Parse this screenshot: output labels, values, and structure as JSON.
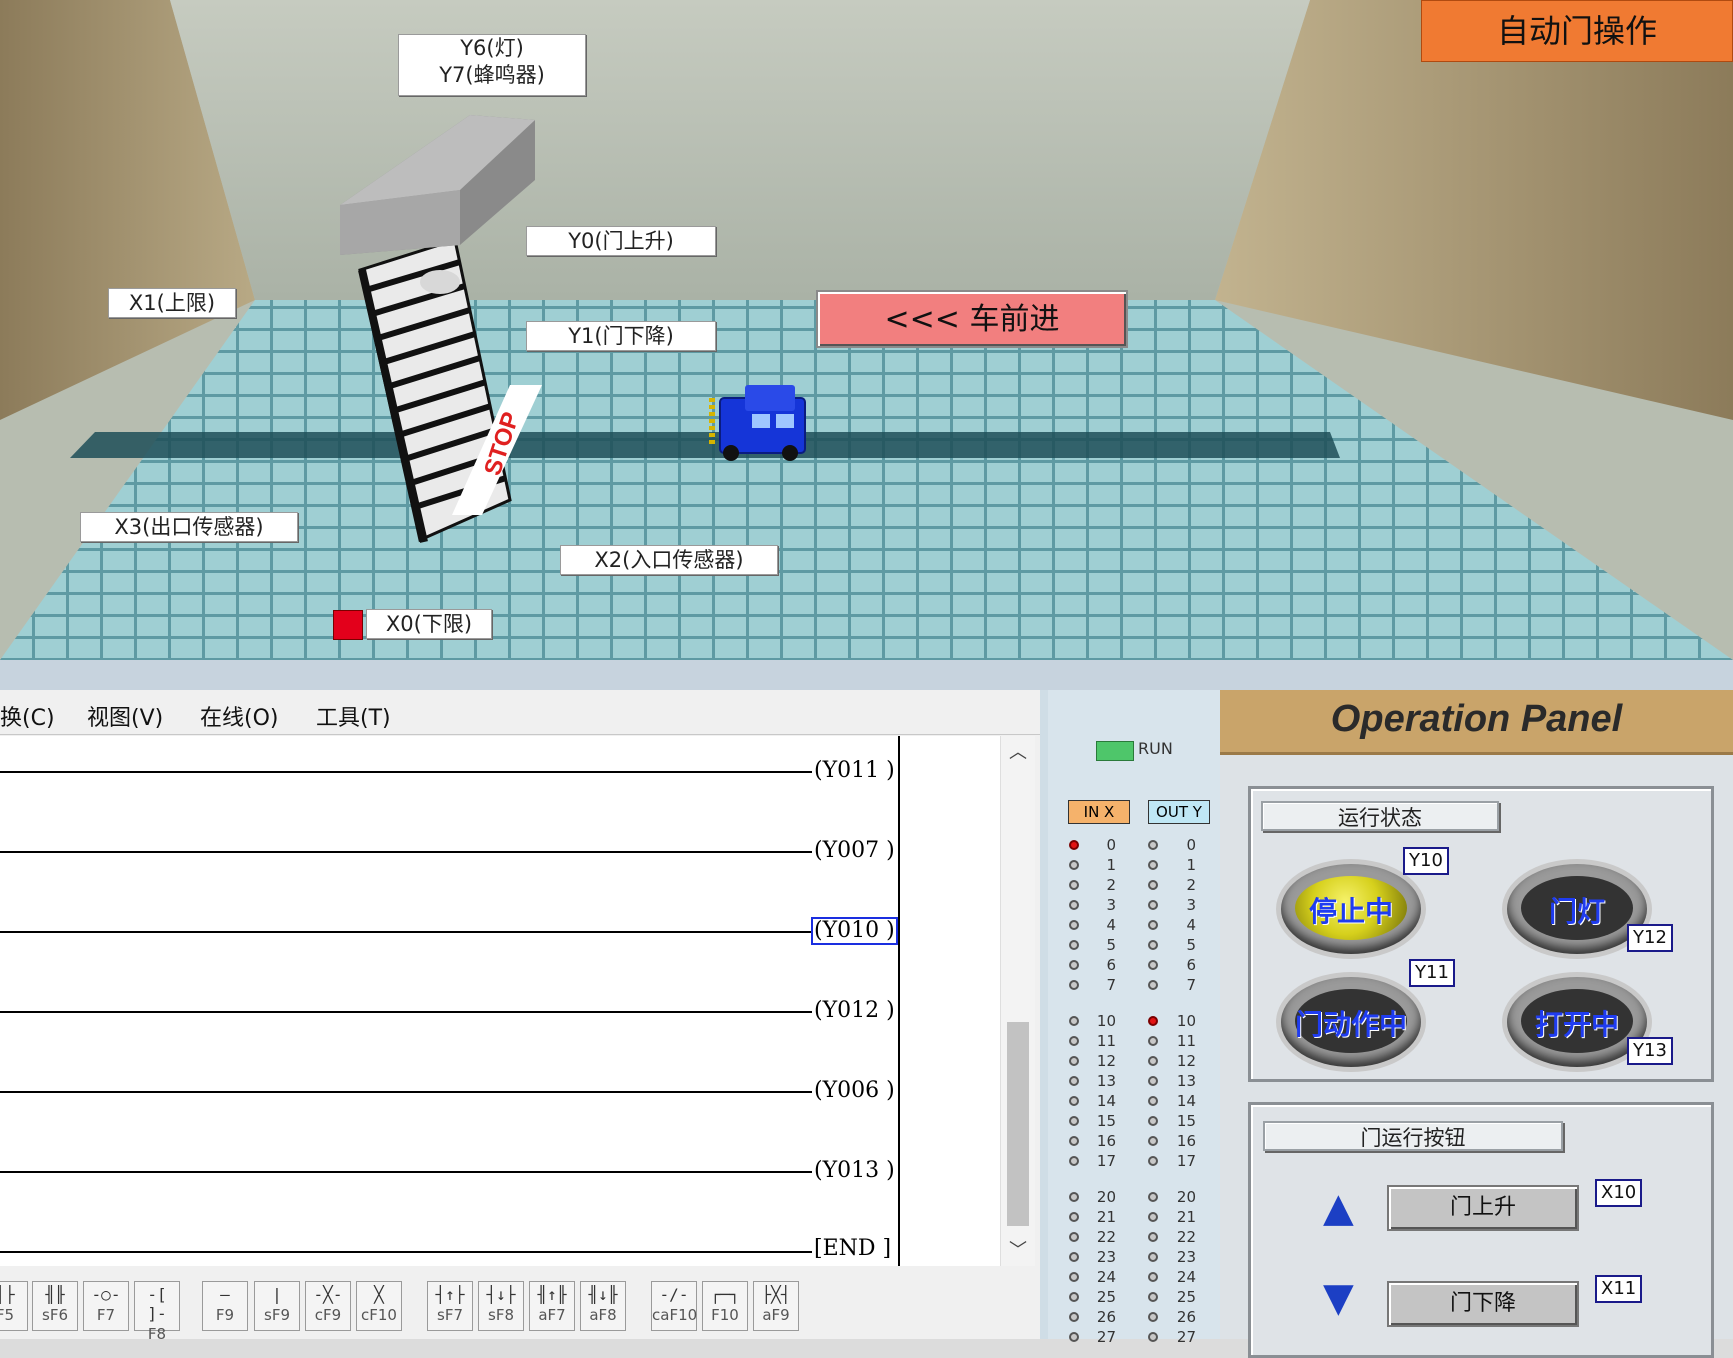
{
  "scene": {
    "title": "自动门操作",
    "car_button": "<<< 车前进",
    "stop_text": "STOP",
    "labels": {
      "y6y7_line1": "Y6(灯)",
      "y6y7_line2": "Y7(蜂鸣器)",
      "y0": "Y0(门上升)",
      "y1": "Y1(门下降)",
      "x1": "X1(上限)",
      "x3": "X3(出口传感器)",
      "x2": "X2(入口传感器)",
      "x0": "X0(下限)"
    }
  },
  "editor": {
    "menu": [
      "换(C)",
      "视图(V)",
      "在线(O)",
      "工具(T)"
    ],
    "coils": [
      "(Y011 )",
      "(Y007 )",
      "(Y010 )",
      "(Y012 )",
      "(Y006 )",
      "(Y013 )",
      "[END ]"
    ],
    "function_keys": [
      {
        "sym": "┤├",
        "label": "F5"
      },
      {
        "sym": "╢╟",
        "label": "sF6"
      },
      {
        "sym": "-○-",
        "label": "F7"
      },
      {
        "sym": "-[ ]-",
        "label": "F8"
      },
      {
        "sym": "—",
        "label": "F9"
      },
      {
        "sym": "|",
        "label": "sF9"
      },
      {
        "sym": "-╳-",
        "label": "cF9"
      },
      {
        "sym": "╳",
        "label": "cF10"
      },
      {
        "sym": "┤↑├",
        "label": "sF7"
      },
      {
        "sym": "┤↓├",
        "label": "sF8"
      },
      {
        "sym": "╢↑╟",
        "label": "aF7"
      },
      {
        "sym": "╢↓╟",
        "label": "aF8"
      },
      {
        "sym": "-/-",
        "label": "caF10"
      },
      {
        "sym": "┌─┐",
        "label": "F10"
      },
      {
        "sym": "├╳┤",
        "label": "aF9"
      }
    ]
  },
  "io": {
    "run_label": "RUN",
    "in_header": "IN X",
    "out_header": "OUT Y",
    "numbers": [
      "0",
      "1",
      "2",
      "3",
      "4",
      "5",
      "6",
      "7",
      "10",
      "11",
      "12",
      "13",
      "14",
      "15",
      "16",
      "17",
      "20",
      "21",
      "22",
      "23",
      "24",
      "25",
      "26",
      "27"
    ],
    "in_on": [
      "0"
    ],
    "out_on": [
      "10"
    ]
  },
  "panel": {
    "title": "Operation Panel",
    "status_group": "运行状态",
    "button_group": "门运行按钮",
    "lamps": {
      "stop": "停止中",
      "light": "门灯",
      "moving": "门动作中",
      "open": "打开中"
    },
    "tags": {
      "y10": "Y10",
      "y11": "Y11",
      "y12": "Y12",
      "y13": "Y13",
      "x10": "X10",
      "x11": "X11"
    },
    "buttons": {
      "up": "门上升",
      "down": "门下降"
    }
  }
}
